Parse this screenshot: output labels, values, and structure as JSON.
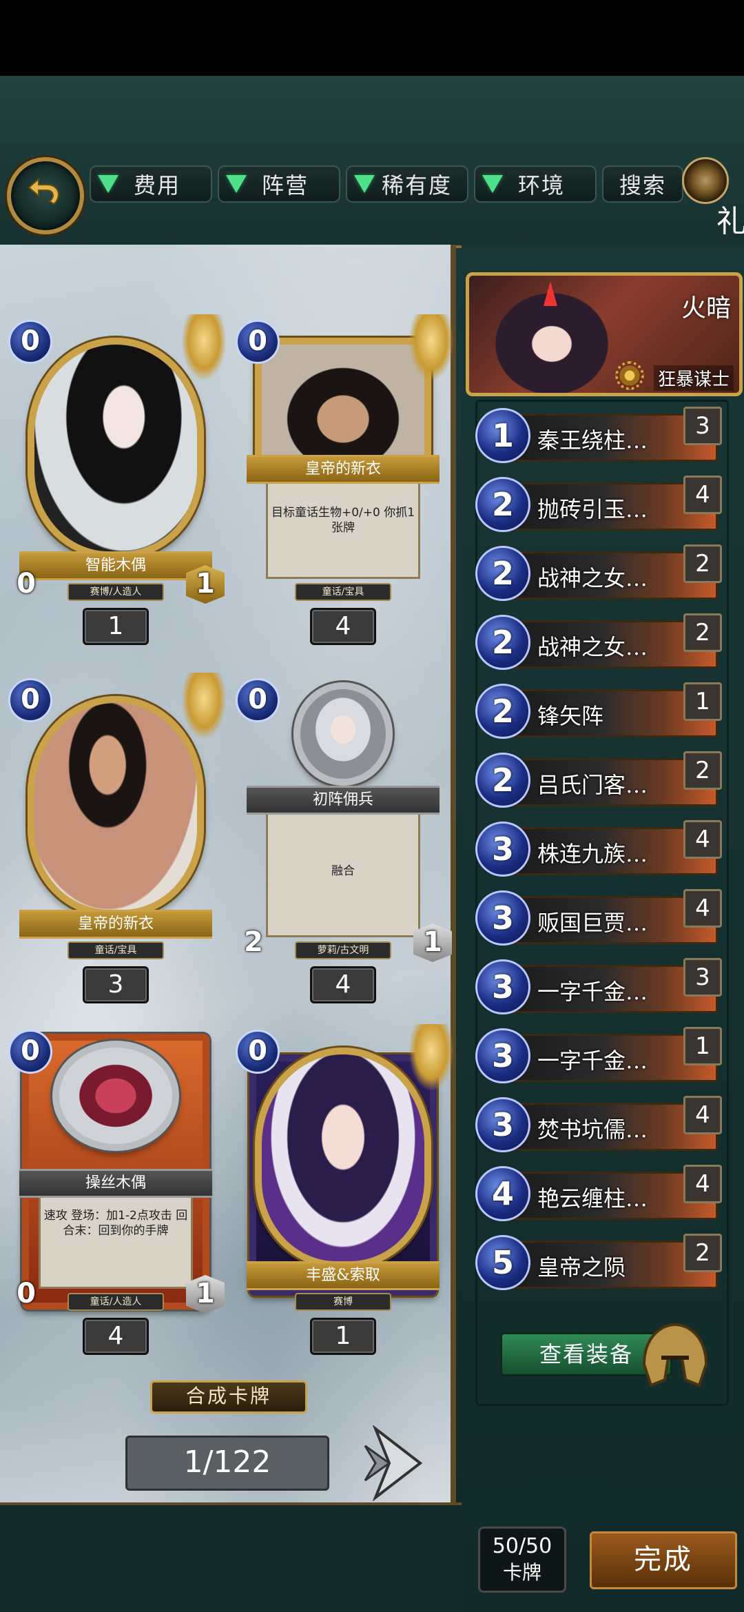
{
  "header": {
    "filters": [
      "费用",
      "阵营",
      "稀有度",
      "环境"
    ],
    "search_label": "搜索",
    "cut_text": "礼"
  },
  "cards": [
    {
      "name": "智能木偶",
      "tribe": "赛博/人造人",
      "cost": "0",
      "attack": "0",
      "health": "1",
      "count": "1",
      "text": ""
    },
    {
      "name": "皇帝的新衣",
      "tribe": "童话/宝具",
      "cost": "0",
      "attack": "",
      "health": "",
      "count": "4",
      "text": "目标童话生物+0/+0 你抓1张牌"
    },
    {
      "name": "皇帝的新衣",
      "tribe": "童话/宝具",
      "cost": "0",
      "attack": "",
      "health": "",
      "count": "3",
      "text": ""
    },
    {
      "name": "初阵佣兵",
      "tribe": "萝莉/古文明",
      "cost": "0",
      "attack": "2",
      "health": "1",
      "count": "4",
      "text": "融合"
    },
    {
      "name": "操丝木偶",
      "tribe": "童话/人造人",
      "cost": "0",
      "attack": "0",
      "health": "1",
      "count": "4",
      "text": "速攻 登场：加1-2点攻击 回合末：回到你的手牌"
    },
    {
      "name": "丰盛&索取",
      "tribe": "赛博",
      "cost": "0",
      "attack": "",
      "health": "",
      "count": "1",
      "text": ""
    }
  ],
  "craft_label": "合成卡牌",
  "pager": "1/122",
  "hero": {
    "name": "火暗",
    "class": "狂暴谋士"
  },
  "deck": [
    {
      "cost": "1",
      "name": "秦王绕柱…",
      "qty": "3"
    },
    {
      "cost": "2",
      "name": "抛砖引玉…",
      "qty": "4"
    },
    {
      "cost": "2",
      "name": "战神之女…",
      "qty": "2"
    },
    {
      "cost": "2",
      "name": "战神之女…",
      "qty": "2"
    },
    {
      "cost": "2",
      "name": "锋矢阵",
      "qty": "1"
    },
    {
      "cost": "2",
      "name": "吕氏门客…",
      "qty": "2"
    },
    {
      "cost": "3",
      "name": "株连九族…",
      "qty": "4"
    },
    {
      "cost": "3",
      "name": "贩国巨贾…",
      "qty": "4"
    },
    {
      "cost": "3",
      "name": "一字千金…",
      "qty": "3"
    },
    {
      "cost": "3",
      "name": "一字千金…",
      "qty": "1"
    },
    {
      "cost": "3",
      "name": "焚书坑儒…",
      "qty": "4"
    },
    {
      "cost": "4",
      "name": "艳云缠柱…",
      "qty": "4"
    },
    {
      "cost": "5",
      "name": "皇帝之陨",
      "qty": "2"
    }
  ],
  "equip_label": "查看装备",
  "deck_count": {
    "value": "50/50",
    "label": "卡牌"
  },
  "done_label": "完成",
  "colors": {
    "accent_gold": "#c9a24a",
    "filter_green": "#4fe08a",
    "frame_teal": "#1d3b3b",
    "done_orange": "#9a5a1c"
  }
}
